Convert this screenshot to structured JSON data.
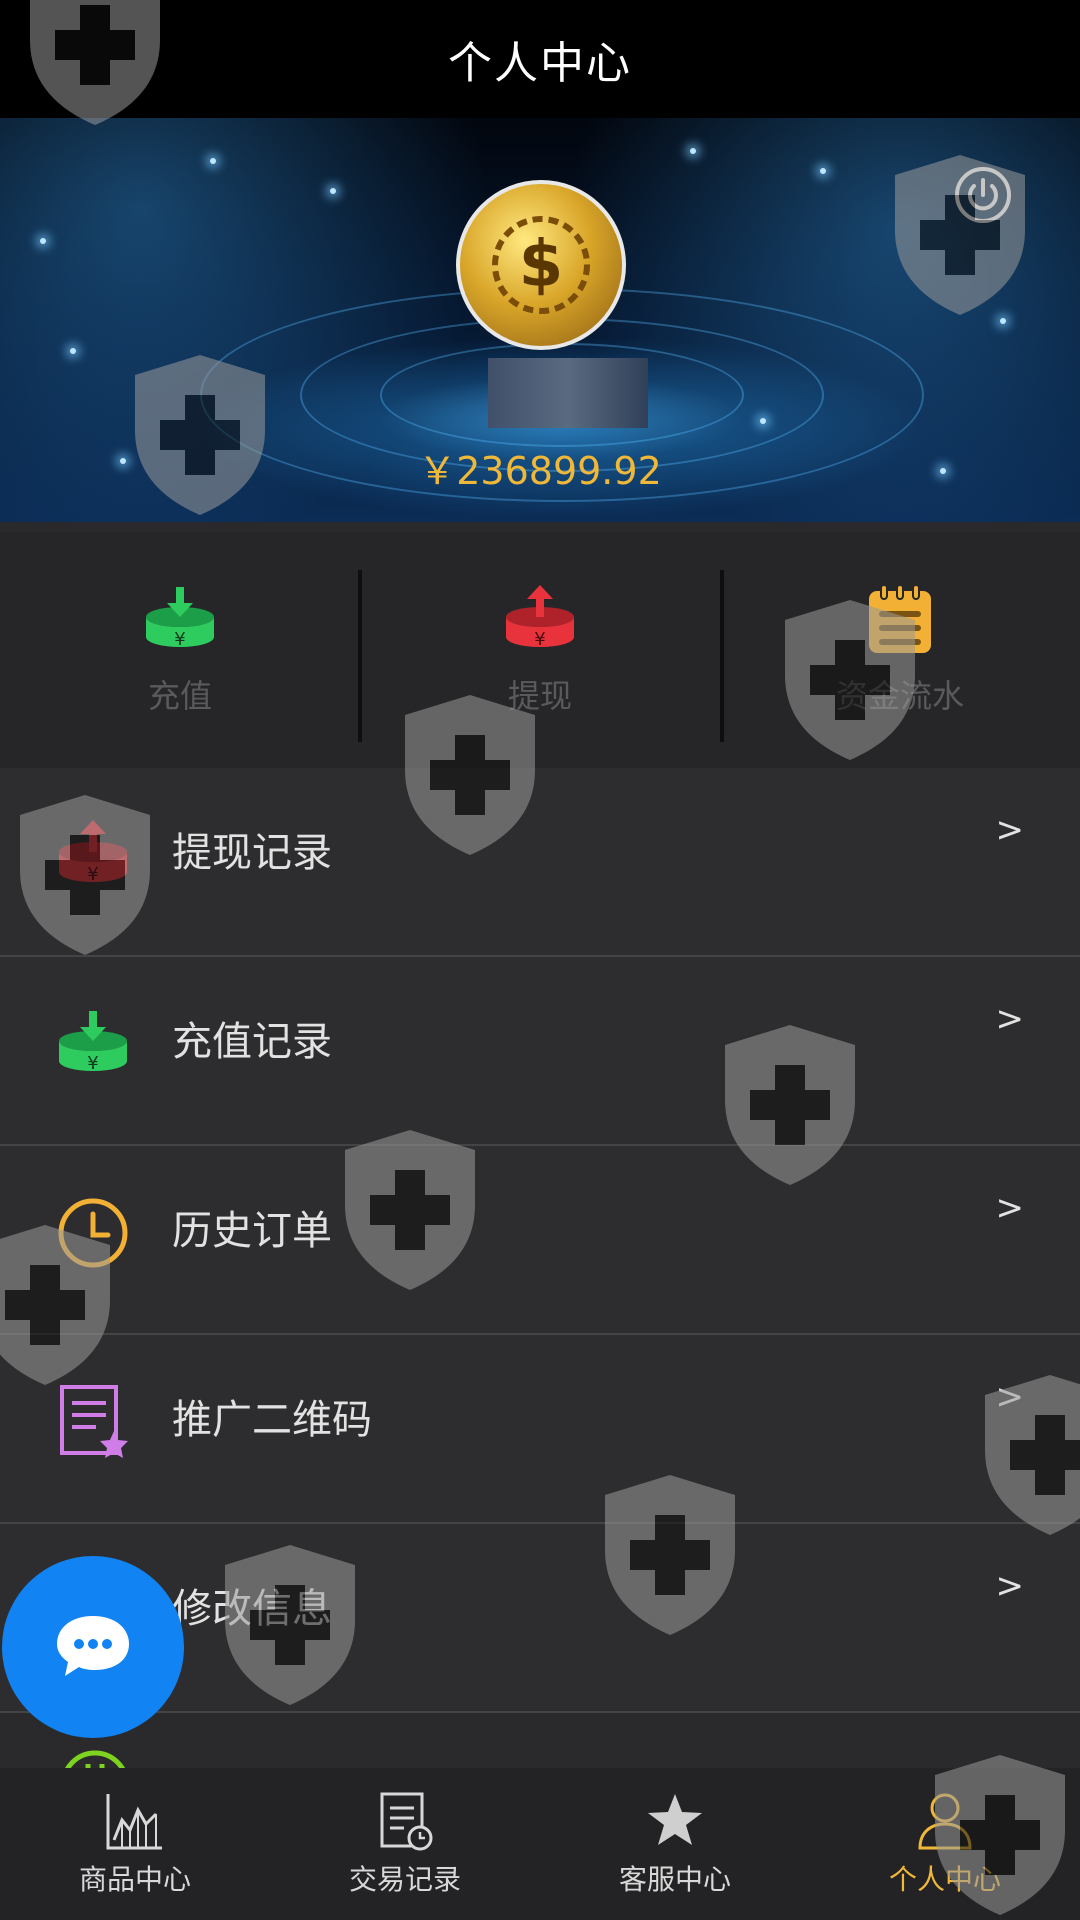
{
  "header": {
    "title": "个人中心"
  },
  "profile": {
    "balance": "￥236899.92"
  },
  "quick_actions": [
    {
      "label": "充值",
      "icon": "deposit-icon",
      "color": "#2ecb5f"
    },
    {
      "label": "提现",
      "icon": "withdraw-icon",
      "color": "#e8333c"
    },
    {
      "label": "资金流水",
      "icon": "ledger-icon",
      "color": "#f2b035"
    }
  ],
  "menu": [
    {
      "label": "提现记录",
      "chevron": ">",
      "icon": "withdraw-record-icon"
    },
    {
      "label": "充值记录",
      "chevron": ">",
      "icon": "deposit-record-icon"
    },
    {
      "label": "历史订单",
      "chevron": ">",
      "icon": "clock-icon"
    },
    {
      "label": "推广二维码",
      "chevron": ">",
      "icon": "qr-promo-icon"
    },
    {
      "label": "修改信息",
      "chevron": ">",
      "icon": "edit-info-icon"
    }
  ],
  "bottom_nav": [
    {
      "label": "商品中心",
      "icon": "chart-icon",
      "active": false
    },
    {
      "label": "交易记录",
      "icon": "receipt-icon",
      "active": false
    },
    {
      "label": "客服中心",
      "icon": "star-icon",
      "active": false
    },
    {
      "label": "个人中心",
      "icon": "person-icon",
      "active": true
    }
  ],
  "colors": {
    "accent": "#f0b838",
    "chat": "#1283f2",
    "background": "#2a2a2c"
  }
}
